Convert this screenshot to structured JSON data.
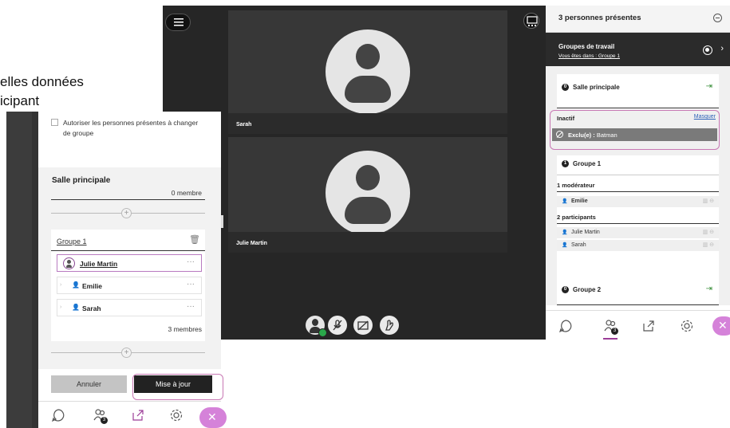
{
  "background_text": {
    "line1": "elles données",
    "line2": "icipant"
  },
  "main": {
    "tiles": [
      {
        "name": "Sarah"
      },
      {
        "name": "Julie Martin"
      }
    ],
    "panel": {
      "title": "3 personnes présentes",
      "groups_bar": {
        "title": "Groupes de travail",
        "subtitle": "Vous êtes dans : Groupe 1"
      },
      "main_room": {
        "num": "0",
        "title": "Salle principale"
      },
      "inactive": {
        "label": "Inactif",
        "hide_link": "Masquer",
        "excluded_label": "Exclu(e) :",
        "excluded_name": "Batman"
      },
      "group1": {
        "num": "1",
        "title": "Groupe 1",
        "moderators_label": "1 modérateur",
        "moderators": [
          "Emilie"
        ],
        "participants_label": "2 participants",
        "participants": [
          "Julie Martin",
          "Sarah"
        ]
      },
      "group2": {
        "num": "0",
        "title": "Groupe 2"
      },
      "footer": {
        "attendees_badge": "3"
      }
    }
  },
  "left": {
    "checkbox_label": "Autoriser les personnes présentes à changer de groupe",
    "main_room_title": "Salle principale",
    "main_room_count": "0 membre",
    "group1": {
      "name": "Groupe 1",
      "members": [
        "Julie Martin",
        "Emilie",
        "Sarah"
      ],
      "count": "3 membres"
    },
    "cancel_label": "Annuler",
    "update_label": "Mise à jour",
    "attendees_badge": "3"
  },
  "colors": {
    "accent": "#c878b4",
    "close": "#d582d9",
    "link": "#2d62b8",
    "presence_ok": "#2aa84a"
  }
}
